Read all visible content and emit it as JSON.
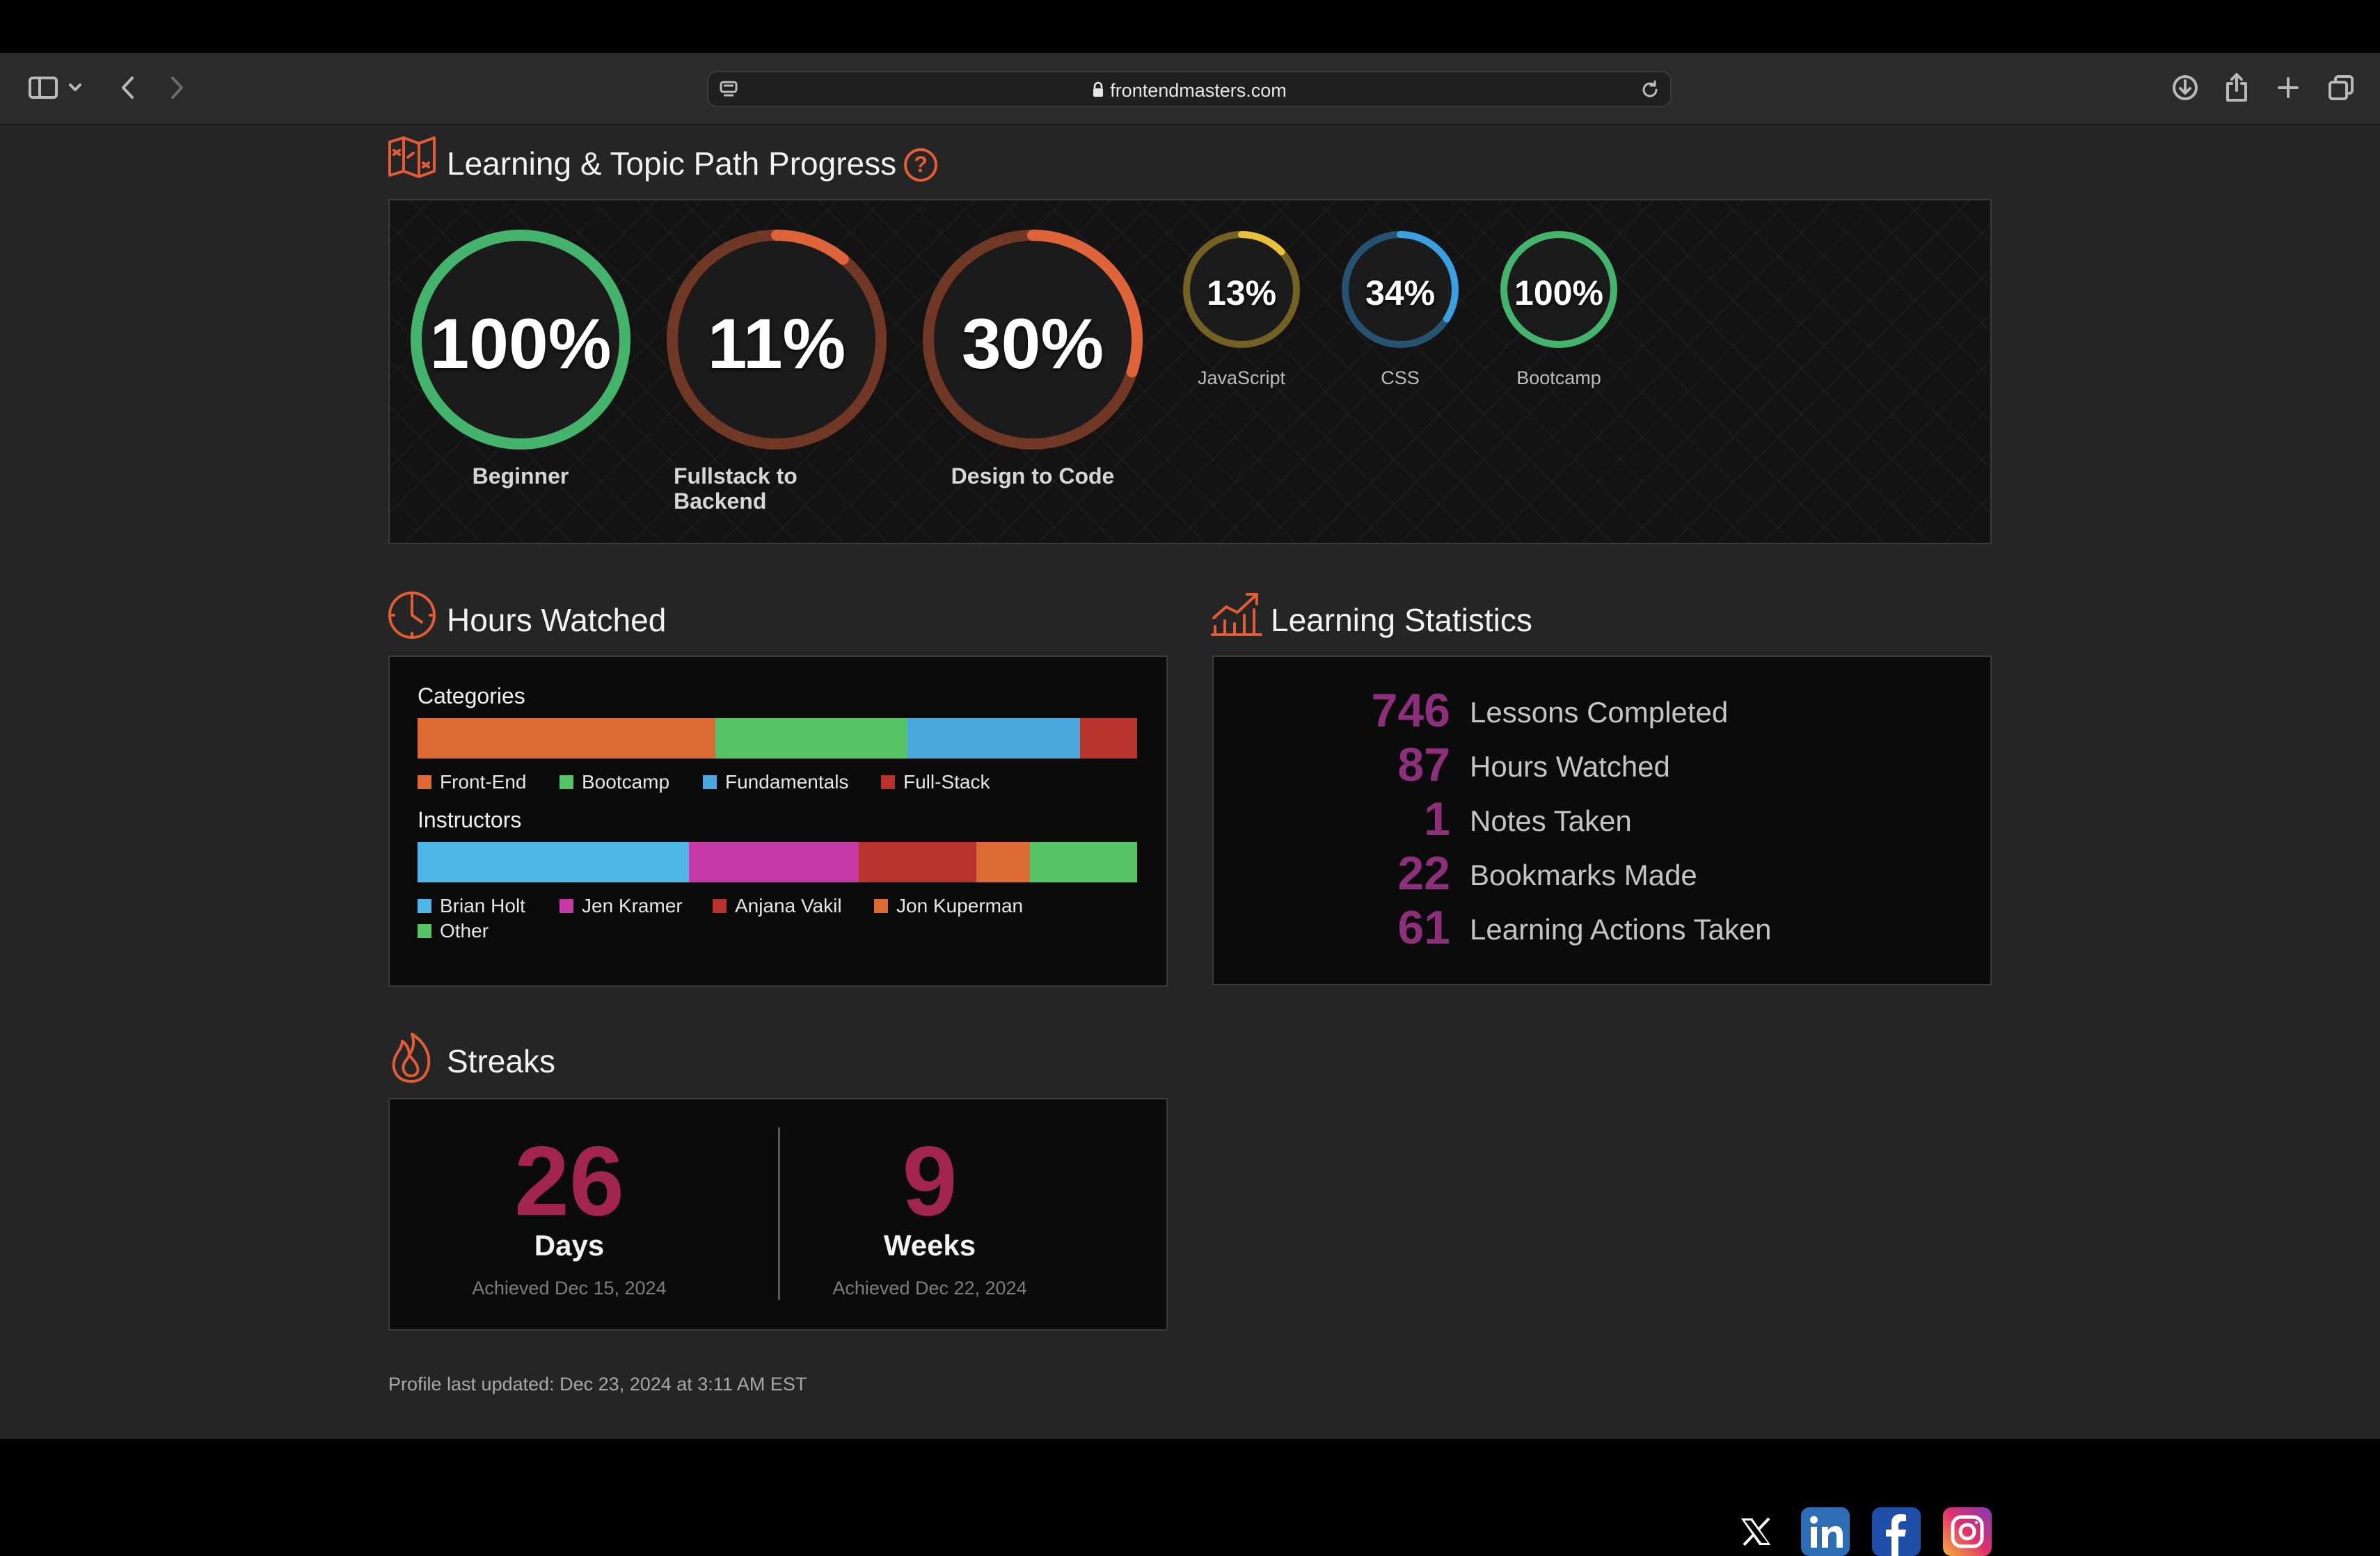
{
  "browser": {
    "url": "frontendmasters.com"
  },
  "learning_paths": {
    "title": "Learning & Topic Path Progress",
    "help_glyph": "?",
    "large": [
      {
        "percent": "100%",
        "label": "Beginner",
        "value": 1.0,
        "color": "#44b36c"
      },
      {
        "percent": "11%",
        "label": "Fullstack to Backend",
        "value": 0.11,
        "color": "#e0643a"
      },
      {
        "percent": "30%",
        "label": "Design to Code",
        "value": 0.3,
        "color": "#e0643a"
      }
    ],
    "small": [
      {
        "percent": "13%",
        "label": "JavaScript",
        "value": 0.13,
        "color": "#e8c13a"
      },
      {
        "percent": "34%",
        "label": "CSS",
        "value": 0.34,
        "color": "#3aa0e0"
      },
      {
        "percent": "100%",
        "label": "Bootcamp",
        "value": 1.0,
        "color": "#44b36c"
      }
    ]
  },
  "hours_watched": {
    "title": "Hours Watched",
    "categories_label": "Categories",
    "categories": [
      {
        "name": "Front-End",
        "value": 41.4,
        "color": "#dd6a33"
      },
      {
        "name": "Bootcamp",
        "value": 26.7,
        "color": "#55c466"
      },
      {
        "name": "Fundamentals",
        "value": 24.0,
        "color": "#4aa8dd"
      },
      {
        "name": "Full-Stack",
        "value": 7.9,
        "color": "#b7332b"
      }
    ],
    "instructors_label": "Instructors",
    "instructors": [
      {
        "name": "Brian Holt",
        "value": 37.7,
        "color": "#4fb6e8"
      },
      {
        "name": "Jen Kramer",
        "value": 23.6,
        "color": "#c63aa8"
      },
      {
        "name": "Anjana Vakil",
        "value": 16.4,
        "color": "#b7332b"
      },
      {
        "name": "Jon Kuperman",
        "value": 7.4,
        "color": "#dd6a33"
      },
      {
        "name": "Other",
        "value": 14.9,
        "color": "#55c466"
      }
    ]
  },
  "learning_statistics": {
    "title": "Learning Statistics",
    "rows": [
      {
        "num": "746",
        "label": "Lessons Completed"
      },
      {
        "num": "87",
        "label": "Hours Watched"
      },
      {
        "num": "1",
        "label": "Notes Taken"
      },
      {
        "num": "22",
        "label": "Bookmarks Made"
      },
      {
        "num": "61",
        "label": "Learning Actions Taken"
      }
    ]
  },
  "streaks": {
    "title": "Streaks",
    "days": {
      "num": "26",
      "unit": "Days",
      "achieved": "Achieved Dec 15, 2024"
    },
    "weeks": {
      "num": "9",
      "unit": "Weeks",
      "achieved": "Achieved Dec 22, 2024"
    }
  },
  "profile_updated": "Profile last updated: Dec 23, 2024 at 3:11 AM EST",
  "social_icons": [
    "x-icon",
    "linkedin-icon",
    "facebook-icon",
    "instagram-icon"
  ]
}
